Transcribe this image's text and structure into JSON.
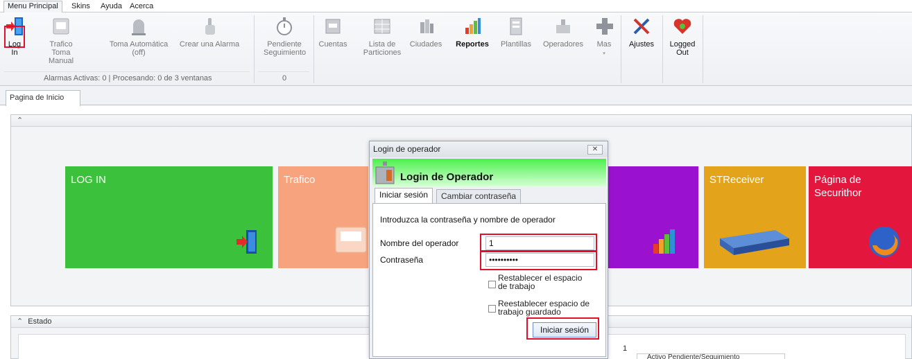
{
  "menu": {
    "tabs": [
      {
        "label": "Menu Principal"
      },
      {
        "label": "Skins"
      },
      {
        "label": "Ayuda"
      },
      {
        "label": "Acerca"
      }
    ]
  },
  "ribbon": {
    "login": {
      "label": "Log In",
      "icon": "login-door-icon"
    },
    "trafico": {
      "label": "Trafico\nToma Manual",
      "icon": "inbox-tray-icon"
    },
    "toma": {
      "label": "Toma Automática\n(off)",
      "icon": "siren-icon"
    },
    "alarma": {
      "label": "Crear una Alarma",
      "icon": "hand-pointer-icon"
    },
    "group1_status": "Alarmas Activas: 0 | Procesando: 0 de 3 ventanas",
    "pendiente": {
      "label": "Pendiente\nSeguimiento",
      "icon": "stopwatch-icon"
    },
    "pendiente_count": "0",
    "cuentas": {
      "label": "Cuentas",
      "icon": "accounts-icon"
    },
    "particiones": {
      "label": "Lista de\nParticiones",
      "icon": "grid-icon"
    },
    "ciudades": {
      "label": "Ciudades",
      "icon": "city-icon"
    },
    "reportes": {
      "label": "Reportes",
      "icon": "bar-chart-icon"
    },
    "plantillas": {
      "label": "Plantillas",
      "icon": "template-icon"
    },
    "operadores": {
      "label": "Operadores",
      "icon": "operators-icon"
    },
    "mas": {
      "label": "Mas",
      "icon": "plus-icon"
    },
    "ajustes": {
      "label": "Ajustes",
      "icon": "tools-icon"
    },
    "logged": {
      "label": "Logged\nOut",
      "icon": "heart-status-icon"
    }
  },
  "doctab": "Pagina de Inicio",
  "estado_label": "Estado",
  "tiles": [
    {
      "title": "LOG IN",
      "color": "#3cc13c"
    },
    {
      "title": "Trafico",
      "color": "#f7a47e"
    },
    {
      "title": "",
      "color": "#9a12cf"
    },
    {
      "title": "STReceiver",
      "color": "#e3a31b"
    },
    {
      "title": "Página de\nSecurithor",
      "color": "#e3173e"
    }
  ],
  "dialog": {
    "title": "Login de operador",
    "banner": "Login de Operador",
    "tab_login": "Iniciar sesión",
    "tab_change": "Cambiar contraseña",
    "instructions": "Introduzca la contraseña y nombre de operador",
    "operator_label": "Nombre del operador",
    "operator_value": "1",
    "password_label": "Contraseña",
    "password_value": "••••••••••",
    "chk1": "Restablecer el espacio\nde trabajo",
    "chk2": "Reestablecer espacio de\ntrabajo guardado",
    "submit": "Iniciar sesión"
  },
  "status_number": "1",
  "legend": "Activo   Pendiente/Seguimiento"
}
